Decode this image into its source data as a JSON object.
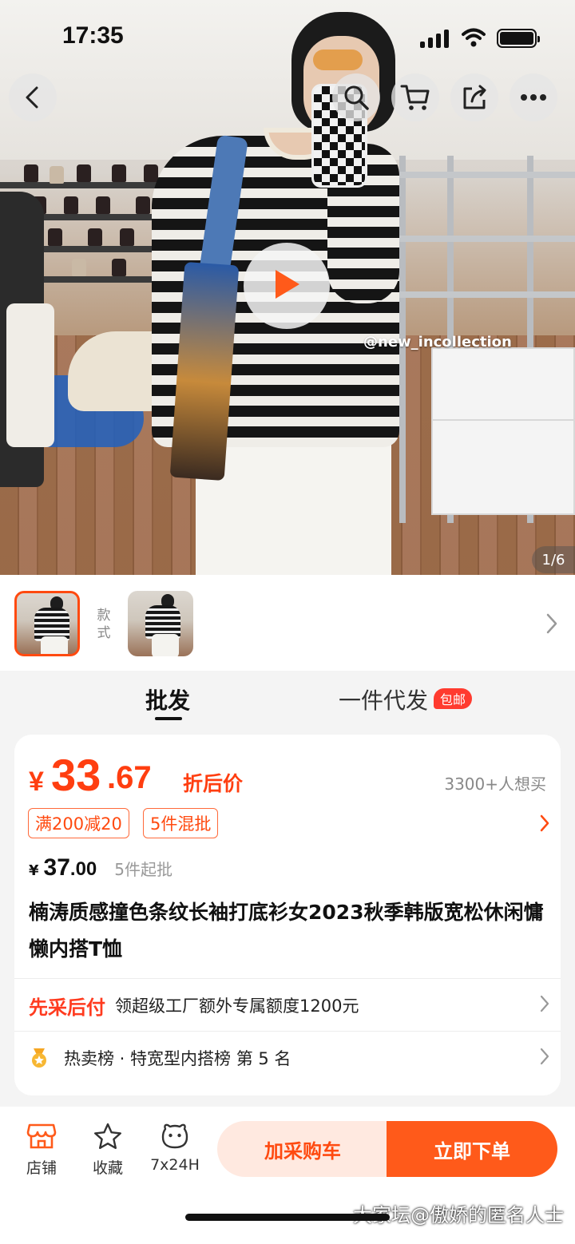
{
  "status_bar": {
    "time": "17:35"
  },
  "hero": {
    "photo_watermark": "@new_incollection",
    "pager": "1/6"
  },
  "variants": {
    "style_label_1": "款",
    "style_label_2": "式"
  },
  "tabs": [
    {
      "label": "批发",
      "active": true
    },
    {
      "label": "一件代发",
      "active": false,
      "badge": "包邮"
    }
  ],
  "price": {
    "currency": "¥",
    "integer": "33",
    "decimal": ".67",
    "tag": "折后价",
    "want_count": "3300+人想买",
    "promos": [
      "满200减20",
      "5件混批"
    ],
    "original_currency": "¥",
    "original_integer": "37",
    "original_decimal": ".00",
    "moq": "5件起批"
  },
  "product": {
    "title": "楠涛质感撞色条纹长袖打底衫女2023秋季韩版宽松休闲慵懒内搭T恤"
  },
  "rows": {
    "credit_highlight": "先采后付",
    "credit_text": "领超级工厂额外专属额度1200元",
    "rank_text": "热卖榜 · 特宽型内搭榜  第 5 名"
  },
  "bottom_bar": {
    "store": "店铺",
    "favorite": "收藏",
    "service": "7x24H",
    "add_to_cart": "加采购车",
    "buy_now": "立即下单"
  },
  "forum_watermark": "大家坛@傲娇的匿名人士",
  "colors": {
    "accent": "#ff5a1a",
    "price": "#ff3e10"
  }
}
